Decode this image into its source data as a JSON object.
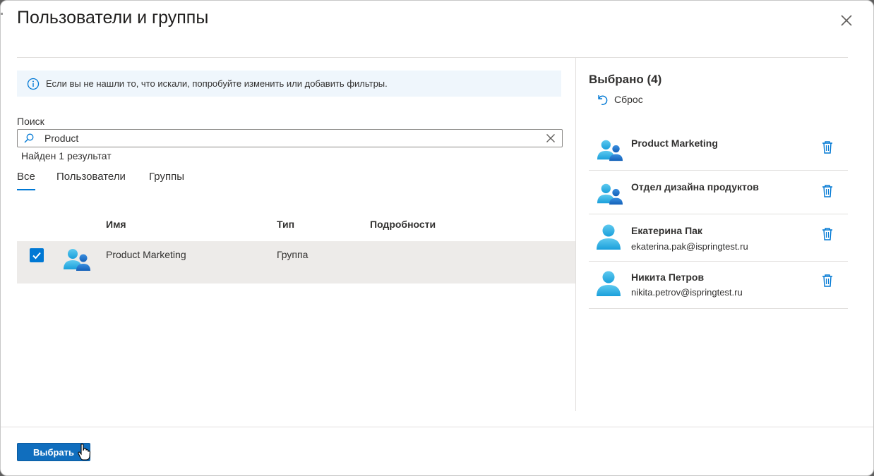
{
  "dialog": {
    "title": "Пользователи и группы",
    "close_icon": "close-icon"
  },
  "info": {
    "icon": "info-icon",
    "text": "Если вы не нашли то, что искали, попробуйте изменить или добавить фильтры."
  },
  "search": {
    "label": "Поиск",
    "value": "Product",
    "result_count": "Найден 1 результат"
  },
  "tabs": [
    {
      "label": "Все",
      "active": true
    },
    {
      "label": "Пользователи",
      "active": false
    },
    {
      "label": "Группы",
      "active": false
    }
  ],
  "table": {
    "headers": {
      "name": "Имя",
      "type": "Тип",
      "details": "Подробности"
    },
    "rows": [
      {
        "checked": true,
        "icon": "group-icon",
        "name": "Product Marketing",
        "type": "Группа",
        "details": ""
      }
    ]
  },
  "selected": {
    "title": "Выбрано (4)",
    "reset_label": "Сброс",
    "items": [
      {
        "icon": "group-icon",
        "name": "Product Marketing",
        "email": ""
      },
      {
        "icon": "group-icon",
        "name": "Отдел дизайна продуктов",
        "email": ""
      },
      {
        "icon": "user-icon",
        "name": "Екатерина Пак",
        "email": "ekaterina.pak@ispringtest.ru"
      },
      {
        "icon": "user-icon",
        "name": "Никита Петров",
        "email": "nikita.petrov@ispringtest.ru"
      }
    ]
  },
  "footer": {
    "select_label": "Выбрать"
  },
  "colors": {
    "accent": "#0078d4",
    "button": "#106ebe",
    "info_bg": "#eff6fc",
    "row_selected": "#edebe9"
  }
}
